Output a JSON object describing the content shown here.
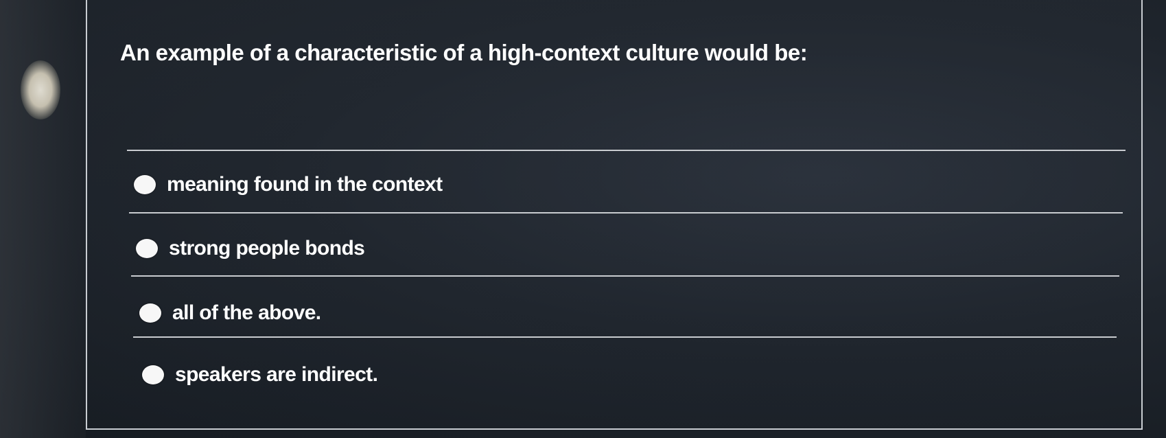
{
  "question": {
    "text": "An example of a characteristic of a high-context culture would be:"
  },
  "options": [
    {
      "label": "meaning found in the context"
    },
    {
      "label": "strong people bonds"
    },
    {
      "label": "all of the above."
    },
    {
      "label": "speakers are indirect."
    }
  ],
  "colors": {
    "background": "#1f252d",
    "text": "#ffffff",
    "divider": "#c9ccd0",
    "radio": "#f7f7f7"
  }
}
